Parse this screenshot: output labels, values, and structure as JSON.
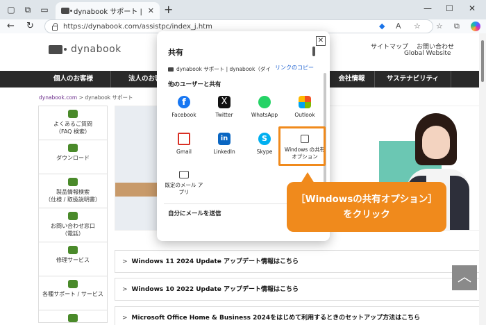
{
  "browser": {
    "tab_title": "dynabook サポート | dynabook（ダ",
    "tab_close": "✕",
    "new_tab": "+",
    "url": "https://dynabook.com/assistpc/index_j.htm",
    "win_min": "—",
    "win_max": "☐",
    "win_close": "✕"
  },
  "site": {
    "logo": "dynabook",
    "top_links": [
      "サイトマップ",
      "お問い合わせ"
    ],
    "global": "Global Website",
    "nav": [
      "個人のお客様",
      "法人のお客様",
      "会社情報",
      "サステナビリティ"
    ],
    "breadcrumb_home": "dynabook.com",
    "breadcrumb_sep": ">",
    "breadcrumb_current": "dynabook サポート",
    "sidebar": [
      "よくあるご質問\n（FAQ 検索）",
      "ダウンロード",
      "製品情報検索\n（仕様 / 取扱説明書）",
      "お問い合わせ窓口\n（電話）",
      "修理サービス",
      "各種サポート / サービス"
    ],
    "news": [
      "Windows 11 2024 Update アップデート情報はこちら",
      "Windows 10 2022 Update アップデート情報はこちら",
      "Microsoft Office Home & Business 2024をはじめて利用するときのセットアップ方法はこちら"
    ],
    "news_arrow": ">",
    "scroll_top": "︿"
  },
  "share": {
    "title": "共有",
    "close": "✕",
    "page_title": "dynabook サポート | dynabook（ダイ",
    "copy_link": "リンクのコピー",
    "section": "他のユーザーと共有",
    "apps": [
      {
        "label": "Facebook",
        "icon": "f"
      },
      {
        "label": "Twitter",
        "icon": "X"
      },
      {
        "label": "WhatsApp",
        "icon": ""
      },
      {
        "label": "Outlook",
        "icon": ""
      },
      {
        "label": "Gmail",
        "icon": ""
      },
      {
        "label": "LinkedIn",
        "icon": "in"
      },
      {
        "label": "Skype",
        "icon": "S"
      },
      {
        "label": "Windows の共有\nオプション",
        "icon": ""
      },
      {
        "label": "既定のメール ア\nプリ",
        "icon": ""
      }
    ],
    "email_self": "自分にメールを送信"
  },
  "callout": {
    "line1": "［Windowsの共有オプション］",
    "line2": "をクリック"
  },
  "colors": {
    "accent": "#f08a1c",
    "nav_bg": "#2a2a2a",
    "link": "#1a5fd0"
  }
}
